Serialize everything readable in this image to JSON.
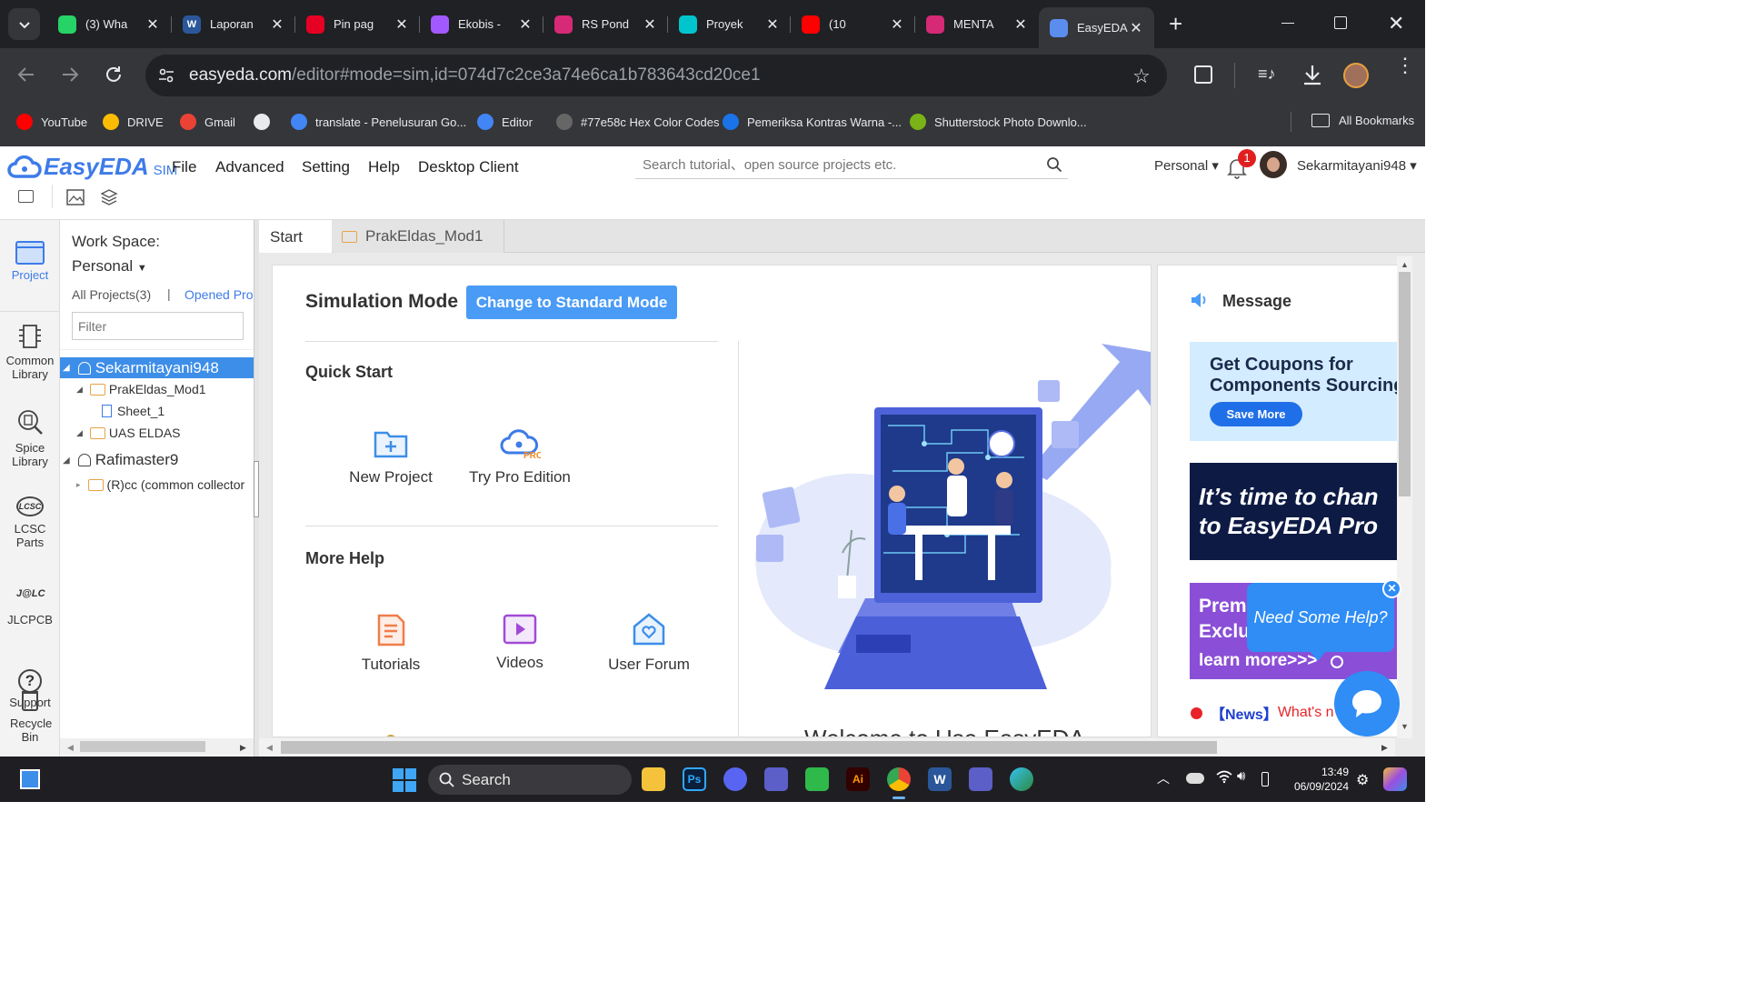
{
  "browser": {
    "tabs": [
      {
        "title": "(3) Wha",
        "icon": "whatsapp-icon",
        "color": "#25d366"
      },
      {
        "title": "Laporan",
        "icon": "word-icon",
        "color": "#2b579a"
      },
      {
        "title": "Pin pag",
        "icon": "pinterest-icon",
        "color": "#e60023"
      },
      {
        "title": "Ekobis -",
        "icon": "figma-icon",
        "color": "#a259ff"
      },
      {
        "title": "RS Pond",
        "icon": "instagram-icon",
        "color": "#d62976"
      },
      {
        "title": "Proyek",
        "icon": "canva-icon",
        "color": "#00c4cc"
      },
      {
        "title": "(10",
        "icon": "youtube-icon",
        "color": "#ff0000"
      },
      {
        "title": "MENTA",
        "icon": "instagram-icon",
        "color": "#d62976"
      },
      {
        "title": "EasyEDA",
        "icon": "easyeda-icon",
        "color": "#5b8def"
      }
    ],
    "url_domain": "easyeda.com",
    "url_path": "/editor#mode=sim,id=074d7c2ce3a74e6ca1b783643cd20ce1",
    "bookmarks": [
      {
        "label": "YouTube",
        "color": "#ff0000"
      },
      {
        "label": "DRIVE",
        "color": "#fbbc04"
      },
      {
        "label": "Gmail",
        "color": "#ea4335"
      },
      {
        "label": "",
        "color": "#e8eaed"
      },
      {
        "label": "translate - Penelusuran Go...",
        "color": "#4285f4"
      },
      {
        "label": "Editor",
        "color": "#4285f4"
      },
      {
        "label": "#77e58c Hex Color Codes",
        "color": "#666666"
      },
      {
        "label": "Pemeriksa Kontras Warna -...",
        "color": "#1a73e8"
      },
      {
        "label": "Shutterstock Photo Downlo...",
        "color": "#7ab317"
      }
    ],
    "all_bookmarks": "All Bookmarks"
  },
  "app": {
    "logo": "EasyEDA",
    "logo_sub": "SIM",
    "menu": [
      "File",
      "Advanced",
      "Setting",
      "Help",
      "Desktop Client"
    ],
    "search_placeholder": "Search tutorial、open source projects etc.",
    "workspace_dropdown": "Personal",
    "notification_count": "1",
    "username": "Sekarmitayani948"
  },
  "leftnav": [
    {
      "label": "Project",
      "icon": "project-icon",
      "active": true
    },
    {
      "label": "Common Library",
      "icon": "common-library-icon"
    },
    {
      "label": "Spice Library",
      "icon": "spice-library-icon"
    },
    {
      "label": "LCSC Parts",
      "icon": "lcsc-icon"
    },
    {
      "label": "JLCPCB",
      "icon": "jlcpcb-icon"
    },
    {
      "label": "Support",
      "icon": "support-icon"
    },
    {
      "label": "Recycle Bin",
      "icon": "recycle-bin-icon"
    }
  ],
  "project_panel": {
    "workspace_label": "Work Space:",
    "workspace_value": "Personal",
    "all_projects": "All Projects(3)",
    "opened_projects": "Opened Pro",
    "filter_placeholder": "Filter",
    "tree": [
      {
        "label": "Sekarmitayani948",
        "type": "user",
        "level": 0,
        "selected": true
      },
      {
        "label": "PrakEldas_Mod1",
        "type": "folder",
        "level": 1
      },
      {
        "label": "Sheet_1",
        "type": "sheet",
        "level": 2
      },
      {
        "label": "UAS ELDAS",
        "type": "folder",
        "level": 1
      },
      {
        "label": "Rafimaster9",
        "type": "user",
        "level": 0
      },
      {
        "label": "(R)cc (common collector",
        "type": "folder",
        "level": 1
      }
    ]
  },
  "doc_tabs": [
    "Start",
    "PrakEldas_Mod1"
  ],
  "start_page": {
    "title": "Simulation Mode",
    "mode_button": "Change to Standard Mode",
    "quick_start": "Quick Start",
    "quick_items": [
      "New Project",
      "Try Pro Edition"
    ],
    "more_help": "More Help",
    "help_items": [
      "Tutorials",
      "Videos",
      "User Forum"
    ],
    "welcome": "Welcome to Use EasyEDA"
  },
  "message_panel": {
    "title": "Message",
    "banner1_line1": "Get Coupons for",
    "banner1_line2": "Components Sourcing",
    "banner1_button": "Save More",
    "banner2_line1": "It’s time to chan",
    "banner2_line2": "to EasyEDA Pro",
    "banner3_line1": "Prem",
    "banner3_line2": "Exclu",
    "banner3_line3": "learn more>>>",
    "news_tag": "【News】",
    "news_text": "What's n",
    "help_bubble": "Need Some Help?"
  },
  "taskbar": {
    "search": "Search",
    "time": "13:49",
    "date": "06/09/2024"
  }
}
